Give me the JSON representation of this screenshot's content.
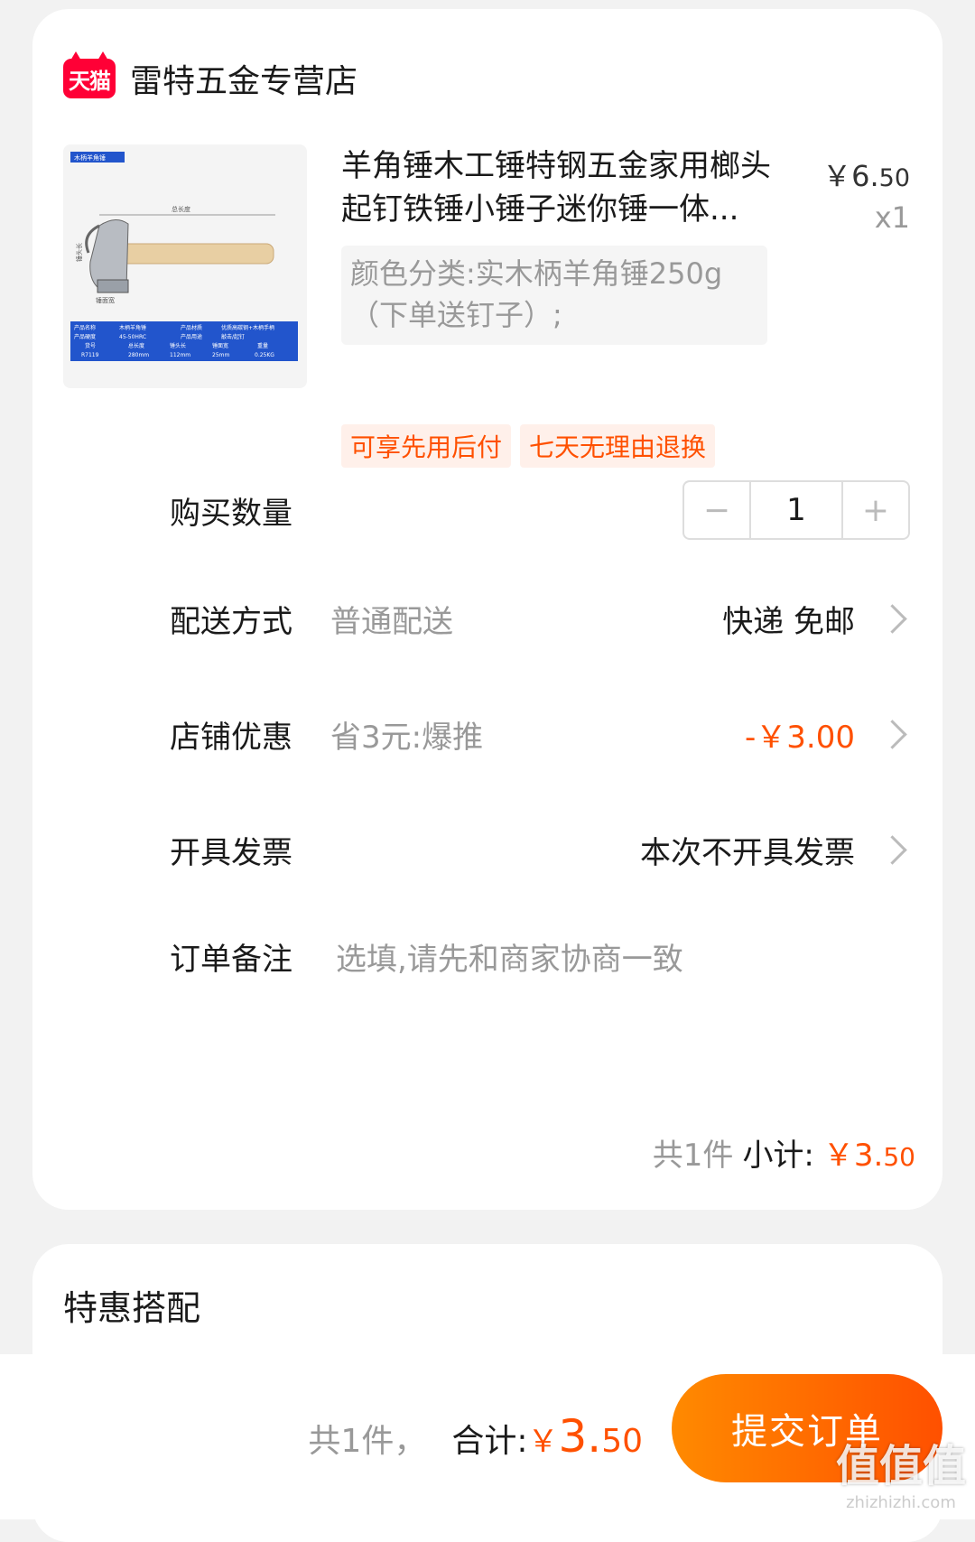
{
  "shop": {
    "badge": "天猫",
    "name": "雷特五金专营店"
  },
  "product": {
    "title": "羊角锤木工锤特钢五金家用榔头起钉铁锤小锤子迷你锤一体...",
    "price_symbol": "￥",
    "price_int": "6.",
    "price_cents": "50",
    "quantity_label": "x1",
    "sku": "颜色分类:实木柄羊角锤250g（下单送钉子）;",
    "image": {
      "banner": "木柄羊角锤",
      "dim_total": "总长度",
      "dim_head": "锤头长",
      "dim_face": "锤面宽",
      "table": [
        [
          "产品名称",
          "木柄羊角锤",
          "产品材质",
          "优质高碳钢+木柄手柄"
        ],
        [
          "产品硬度",
          "45-50HRC",
          "产品用途",
          "敲击/起钉"
        ],
        [
          "货号",
          "总长度",
          "锤头长",
          "锤面宽",
          "重量"
        ],
        [
          "R7119",
          "280mm",
          "112mm",
          "25mm",
          "0.25KG"
        ]
      ]
    },
    "tags": [
      "可享先用后付",
      "七天无理由退换"
    ]
  },
  "rows": {
    "quantity": {
      "label": "购买数量",
      "minus": "−",
      "value": "1",
      "plus": "+"
    },
    "delivery": {
      "label": "配送方式",
      "sub": "普通配送",
      "value": "快递 免邮"
    },
    "discount": {
      "label": "店铺优惠",
      "sub": "省3元:爆推",
      "value": "-￥3.00"
    },
    "invoice": {
      "label": "开具发票",
      "value": "本次不开具发票"
    },
    "remark": {
      "label": "订单备注",
      "placeholder": "选填,请先和商家协商一致"
    }
  },
  "subtotal": {
    "count": "共1件",
    "label": "小计:",
    "symbol": "￥",
    "int": "3.",
    "cents": "50"
  },
  "combo": {
    "title": "特惠搭配"
  },
  "footer": {
    "count": "共1件，",
    "label": "合计:",
    "symbol": "￥",
    "int": "3.",
    "cents": "50",
    "submit": "提交订单"
  },
  "watermark": {
    "text": "值值值",
    "url": "zhizhizhi.com"
  },
  "colors": {
    "accent": "#ff5000",
    "tmall": "#ff0036"
  }
}
